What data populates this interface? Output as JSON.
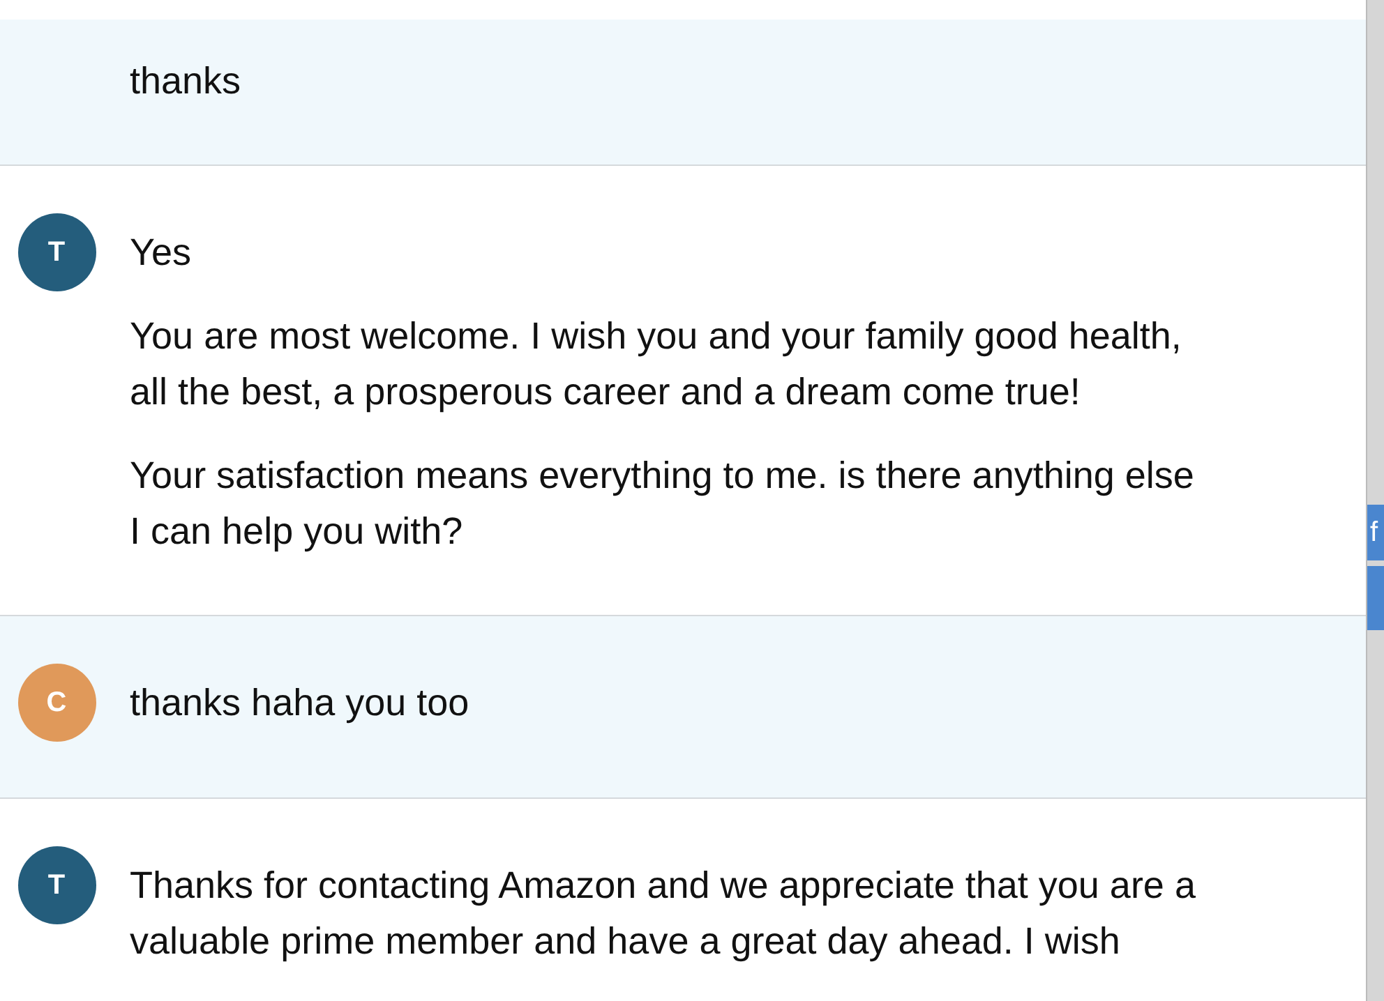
{
  "messages": [
    {
      "kind": "customer",
      "paragraphs": [
        "thanks"
      ]
    },
    {
      "kind": "agent",
      "avatar": "T",
      "paragraphs": [
        "Yes",
        "You are most welcome. I wish you and your family good health, all the best, a prosperous career and a dream come true!",
        "Your satisfaction means everything to me. is there anything else I can help you with?"
      ]
    },
    {
      "kind": "customer",
      "avatar": "C",
      "paragraphs": [
        "thanks haha you too"
      ]
    },
    {
      "kind": "agent",
      "avatar": "T",
      "paragraphs": [
        "Thanks for contacting Amazon and we appreciate that you are a valuable prime member and have a great day ahead. I wish"
      ]
    }
  ],
  "side_tabs": [
    {
      "label": "f"
    }
  ]
}
